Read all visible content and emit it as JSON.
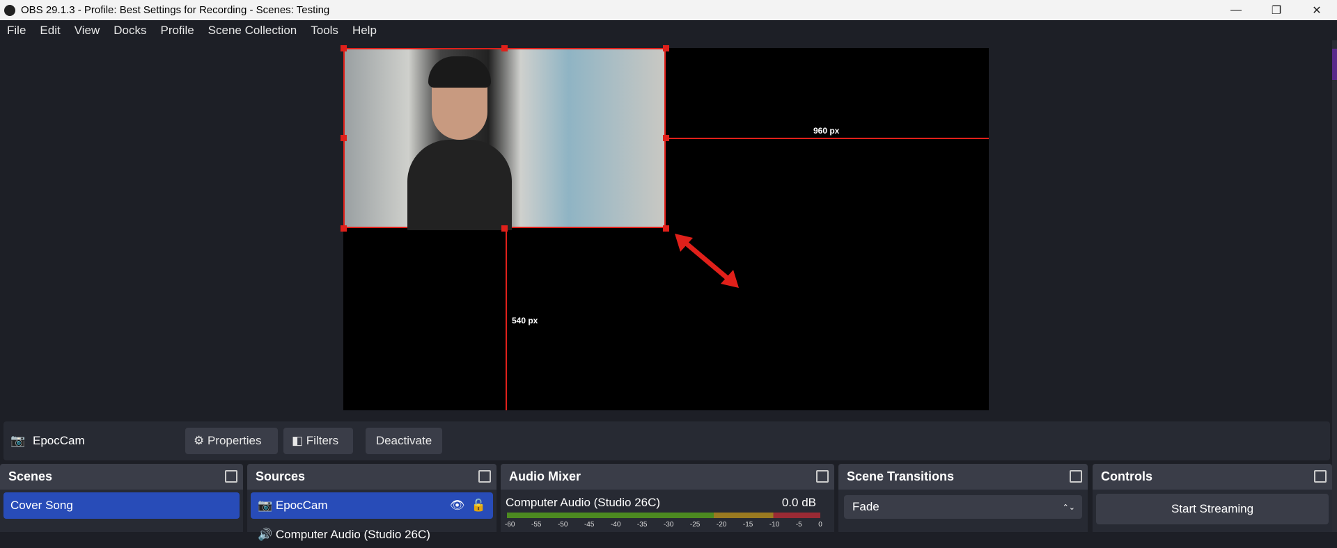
{
  "window": {
    "title": "OBS 29.1.3 - Profile: Best Settings for Recording - Scenes: Testing",
    "minimize": "—",
    "maximize": "❐",
    "close": "✕"
  },
  "menu": [
    "File",
    "Edit",
    "View",
    "Docks",
    "Profile",
    "Scene Collection",
    "Tools",
    "Help"
  ],
  "preview": {
    "width_label": "960 px",
    "height_label": "540 px",
    "selection_color": "#e0201a"
  },
  "context": {
    "source": "EpocCam",
    "properties": "Properties",
    "filters": "Filters",
    "deactivate": "Deactivate"
  },
  "scenes": {
    "title": "Scenes",
    "items": [
      "Cover Song"
    ]
  },
  "sources": {
    "title": "Sources",
    "items": [
      "EpocCam",
      "Computer Audio (Studio 26C)"
    ]
  },
  "mixer": {
    "title": "Audio Mixer",
    "channel": "Computer Audio (Studio 26C)",
    "level": "0.0 dB",
    "ticks": [
      "-60",
      "-55",
      "-50",
      "-45",
      "-40",
      "-35",
      "-30",
      "-25",
      "-20",
      "-15",
      "-10",
      "-5",
      "0"
    ]
  },
  "transitions": {
    "title": "Scene Transitions",
    "selected": "Fade"
  },
  "controls": {
    "title": "Controls",
    "start_streaming": "Start Streaming"
  },
  "accent": "#284cb8"
}
